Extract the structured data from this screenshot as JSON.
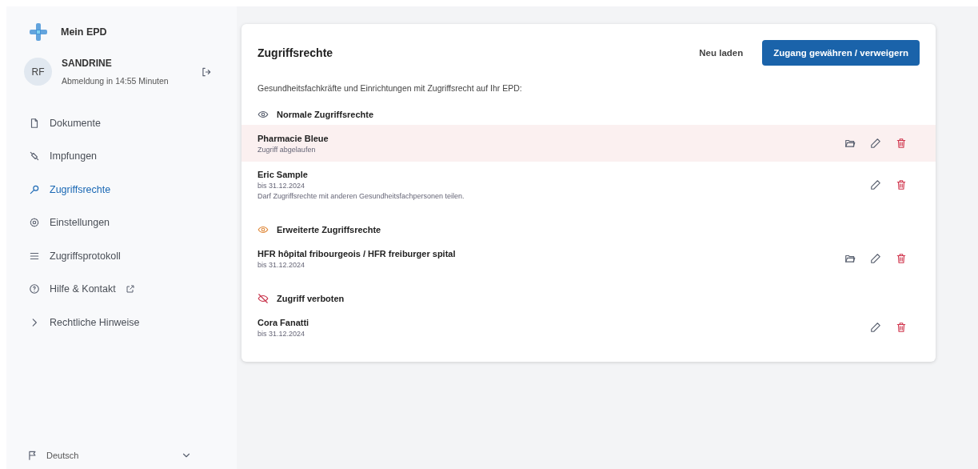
{
  "app": {
    "title": "Mein EPD"
  },
  "user": {
    "initials": "RF",
    "name": "SANDRINE",
    "session": "Abmeldung in 14:55 Minuten"
  },
  "nav": [
    {
      "kind": "document",
      "label": "Dokumente",
      "selected": false,
      "external": false
    },
    {
      "kind": "syringe",
      "label": "Impfungen",
      "selected": false,
      "external": false
    },
    {
      "kind": "key",
      "label": "Zugriffsrechte",
      "selected": true,
      "external": false
    },
    {
      "kind": "gear",
      "label": "Einstellungen",
      "selected": false,
      "external": false
    },
    {
      "kind": "list",
      "label": "Zugriffsprotokoll",
      "selected": false,
      "external": false
    },
    {
      "kind": "help",
      "label": "Hilfe & Kontakt",
      "selected": false,
      "external": true
    },
    {
      "kind": "chevron",
      "label": "Rechtliche Hinweise",
      "selected": false,
      "external": false
    }
  ],
  "language": {
    "value": "Deutsch"
  },
  "card": {
    "title": "Zugriffsrechte",
    "reload_button": "Neu laden",
    "primary_button": "Zugang gewähren / verweigern",
    "intro": "Gesundheitsfachkräfte und Einrichtungen mit Zugriffsrecht auf Ihr EPD:",
    "sections": [
      {
        "kind": "normal",
        "title": "Normale Zugriffsrechte",
        "entries": [
          {
            "name": "Pharmacie Bleue",
            "details": [
              "Zugriff abgelaufen"
            ],
            "expired": true,
            "folder_button": true
          },
          {
            "name": "Eric Sample",
            "details": [
              "bis 31.12.2024",
              "Darf Zugriffsrechte mit anderen Gesundheitsfachpersonen teilen."
            ],
            "expired": false,
            "folder_button": false
          }
        ]
      },
      {
        "kind": "extended",
        "title": "Erweiterte Zugriffsrechte",
        "entries": [
          {
            "name": "HFR hôpital fribourgeois / HFR freiburger spital",
            "details": [
              "bis 31.12.2024"
            ],
            "expired": false,
            "folder_button": true
          }
        ]
      },
      {
        "kind": "forbidden",
        "title": "Zugriff verboten",
        "entries": [
          {
            "name": "Cora Fanatti",
            "details": [
              "bis 31.12.2024"
            ],
            "expired": false,
            "folder_button": false
          }
        ]
      }
    ]
  }
}
